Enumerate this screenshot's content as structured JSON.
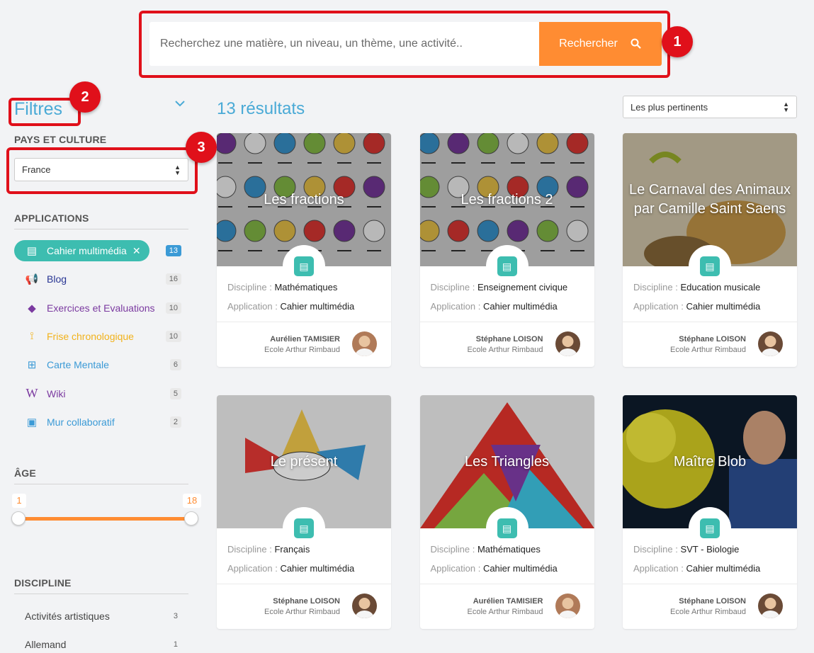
{
  "search": {
    "placeholder": "Recherchez une matière, un niveau, un thème, une activité..",
    "button": "Rechercher"
  },
  "annotations": [
    "1",
    "2",
    "3"
  ],
  "sidebar": {
    "title": "Filtres",
    "country": {
      "label": "PAYS ET CULTURE",
      "value": "France"
    },
    "applications": {
      "label": "APPLICATIONS",
      "items": [
        {
          "label": "Cahier multimédia",
          "count": "13",
          "color": "#3dbdb0",
          "active": true,
          "icon": "notebook-icon"
        },
        {
          "label": "Blog",
          "count": "16",
          "color": "#283593",
          "icon": "megaphone-icon"
        },
        {
          "label": "Exercices et Evaluations",
          "count": "10",
          "color": "#7b3aa0",
          "icon": "cubes-icon"
        },
        {
          "label": "Frise chronologique",
          "count": "10",
          "color": "#f2b21b",
          "icon": "timeline-icon"
        },
        {
          "label": "Carte Mentale",
          "count": "6",
          "color": "#3b9ad6",
          "icon": "sitemap-icon"
        },
        {
          "label": "Wiki",
          "count": "5",
          "color": "#7b3aa0",
          "icon": "wiki-icon"
        },
        {
          "label": "Mur collaboratif",
          "count": "2",
          "color": "#3b9ad6",
          "icon": "wall-icon"
        }
      ]
    },
    "age": {
      "label": "ÂGE",
      "min": "1",
      "max": "18"
    },
    "discipline": {
      "label": "DISCIPLINE",
      "items": [
        {
          "label": "Activités artistiques",
          "count": "3"
        },
        {
          "label": "Allemand",
          "count": "1"
        }
      ]
    }
  },
  "results": {
    "count_label": "13 résultats",
    "sort": "Les plus pertinents"
  },
  "card_labels": {
    "discipline": "Discipline : ",
    "application": "Application : "
  },
  "cards": [
    {
      "title": "Les fractions",
      "discipline": "Mathématiques",
      "application": "Cahier multimédia",
      "author": "Aurélien TAMISIER",
      "school": "Ecole Arthur Rimbaud"
    },
    {
      "title": "Les fractions 2",
      "discipline": "Enseignement civique",
      "application": "Cahier multimédia",
      "author": "Stéphane LOISON",
      "school": "Ecole Arthur Rimbaud"
    },
    {
      "title": "Le Carnaval des Animaux par Camille Saint Saens",
      "discipline": "Education musicale",
      "application": "Cahier multimédia",
      "author": "Stéphane LOISON",
      "school": "Ecole Arthur Rimbaud"
    },
    {
      "title": "Le présent",
      "discipline": "Français",
      "application": "Cahier multimédia",
      "author": "Stéphane LOISON",
      "school": "Ecole Arthur Rimbaud"
    },
    {
      "title": "Les Triangles",
      "discipline": "Mathématiques",
      "application": "Cahier multimédia",
      "author": "Aurélien TAMISIER",
      "school": "Ecole Arthur Rimbaud"
    },
    {
      "title": "Maître Blob",
      "discipline": "SVT - Biologie",
      "application": "Cahier multimédia",
      "author": "Stéphane LOISON",
      "school": "Ecole Arthur Rimbaud"
    }
  ]
}
